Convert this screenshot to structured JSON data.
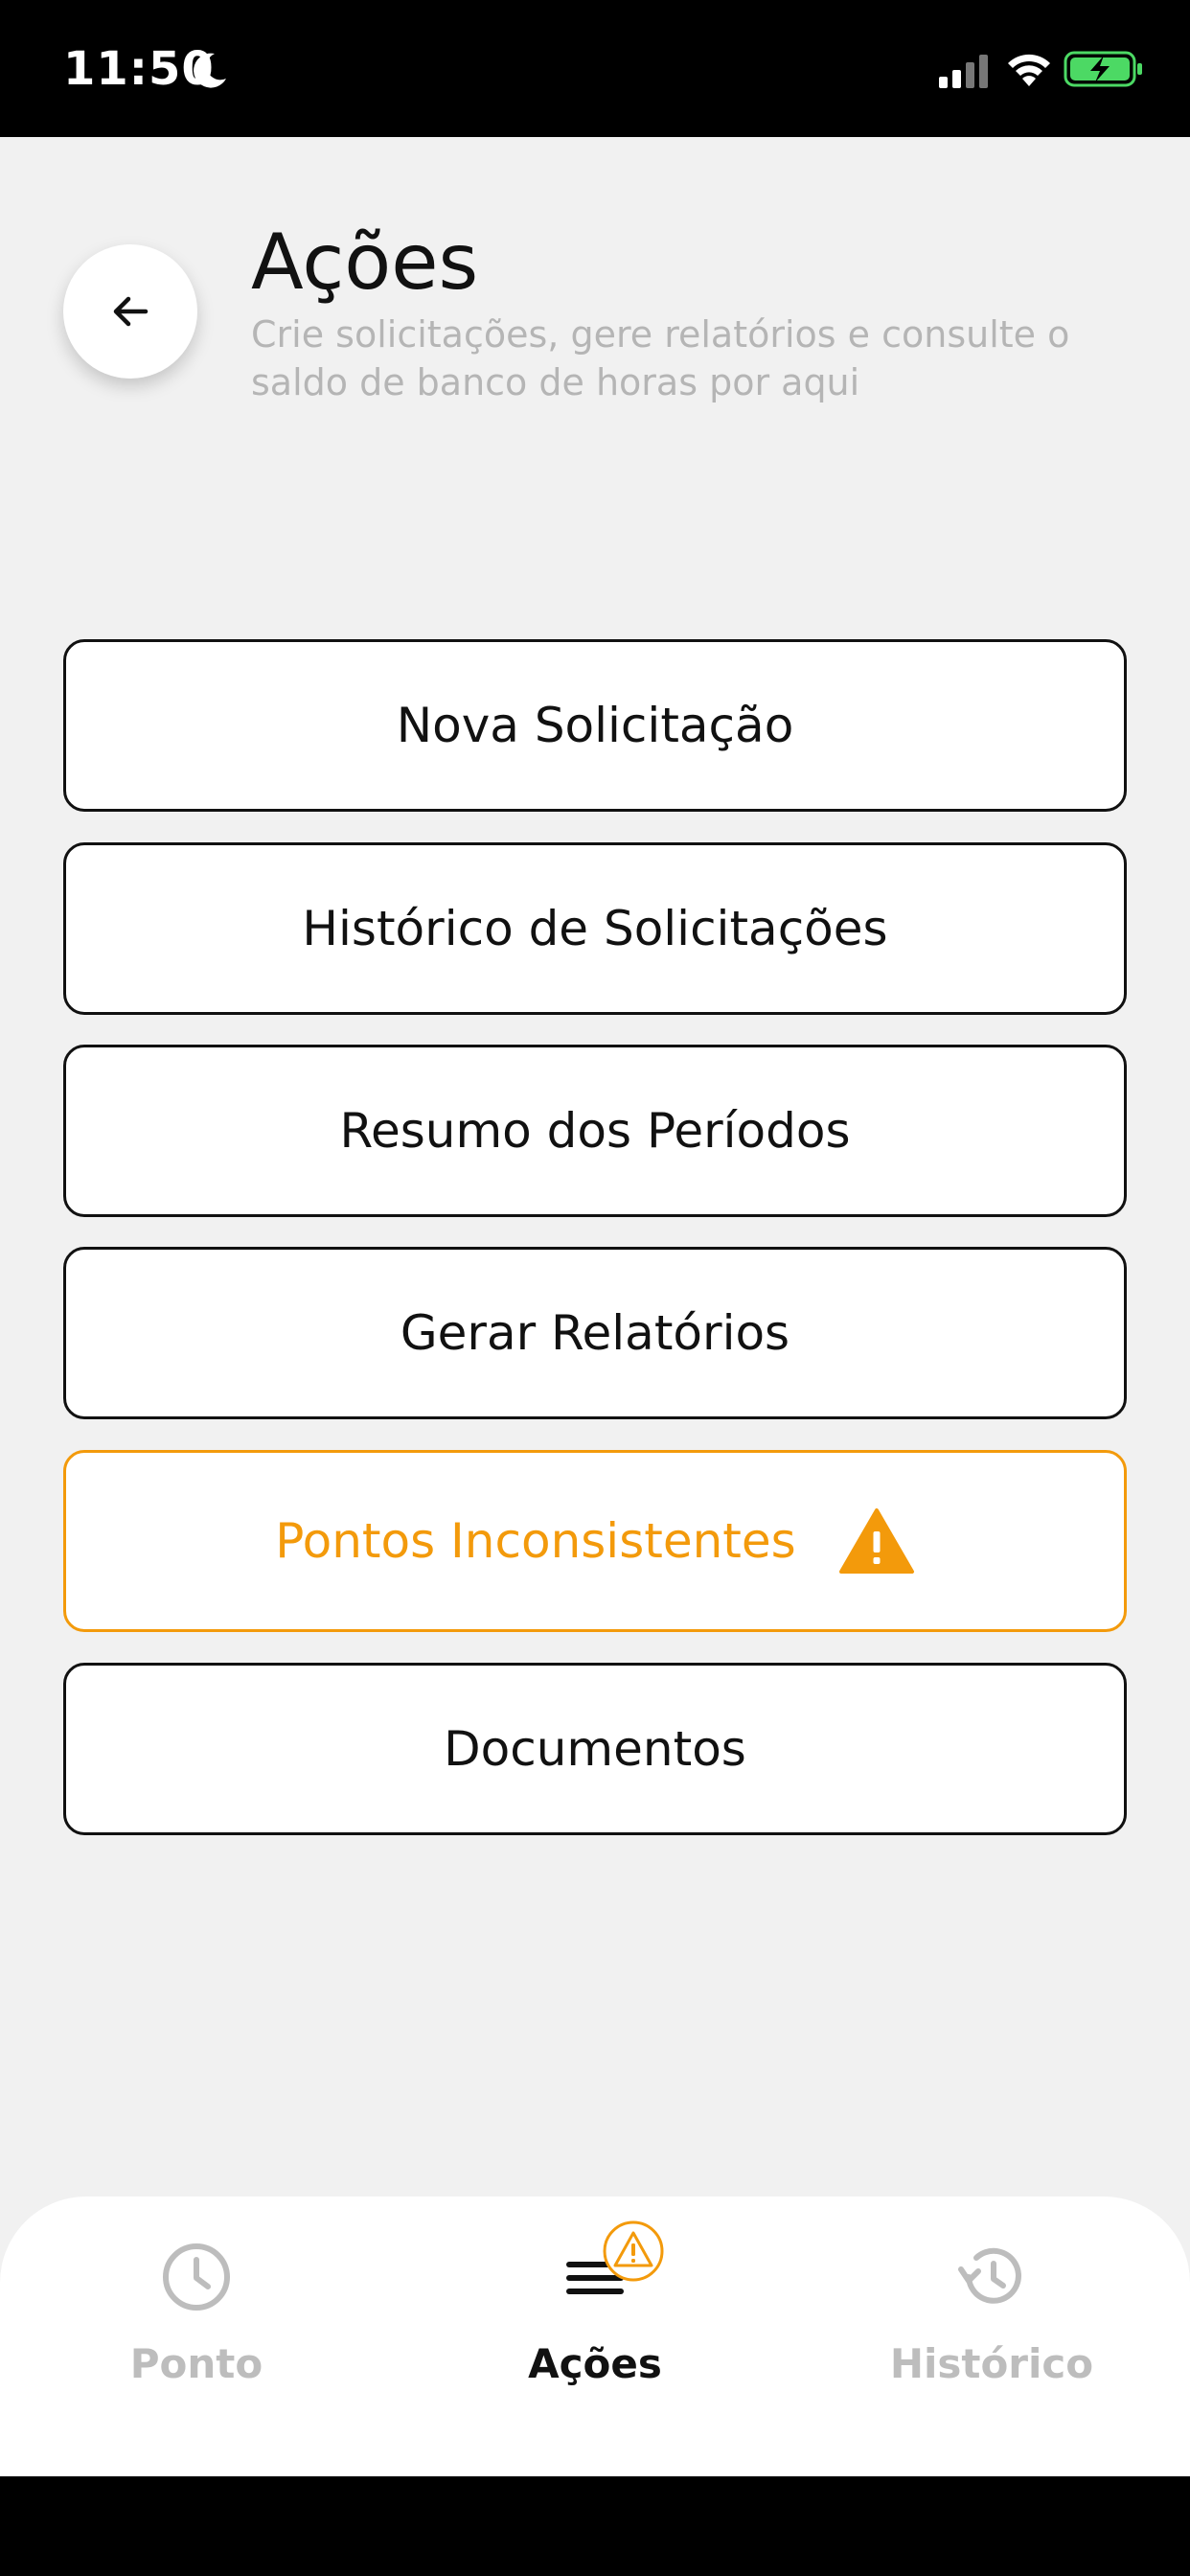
{
  "status_bar": {
    "time": "11:50",
    "moon_icon": "moon-icon",
    "signal_icon": "cellular-signal-icon",
    "wifi_icon": "wifi-icon",
    "battery_icon": "battery-charging-icon",
    "battery_color": "#4cd964"
  },
  "header": {
    "back_icon": "arrow-left-icon",
    "title": "Ações",
    "subtitle": "Crie solicitações, gere relatórios e consulte o saldo de banco de horas por aqui"
  },
  "menu": {
    "items": [
      {
        "label": "Nova Solicitação"
      },
      {
        "label": "Histórico de Solicitações"
      },
      {
        "label": "Resumo dos Períodos"
      },
      {
        "label": "Gerar Relatórios"
      },
      {
        "label": "Pontos Inconsistentes",
        "icon": "warning-icon",
        "color": "#f39a0b"
      },
      {
        "label": "Documentos"
      }
    ]
  },
  "bottom_nav": {
    "items": [
      {
        "label": "Ponto",
        "icon": "clock-icon",
        "active": false
      },
      {
        "label": "Ações",
        "icon": "menu-icon",
        "active": true,
        "badge_icon": "warning-icon"
      },
      {
        "label": "Histórico",
        "icon": "history-icon",
        "active": false
      }
    ],
    "active_color": "#111111",
    "inactive_color": "#bdbdbd",
    "accent_color": "#f39a0b"
  }
}
